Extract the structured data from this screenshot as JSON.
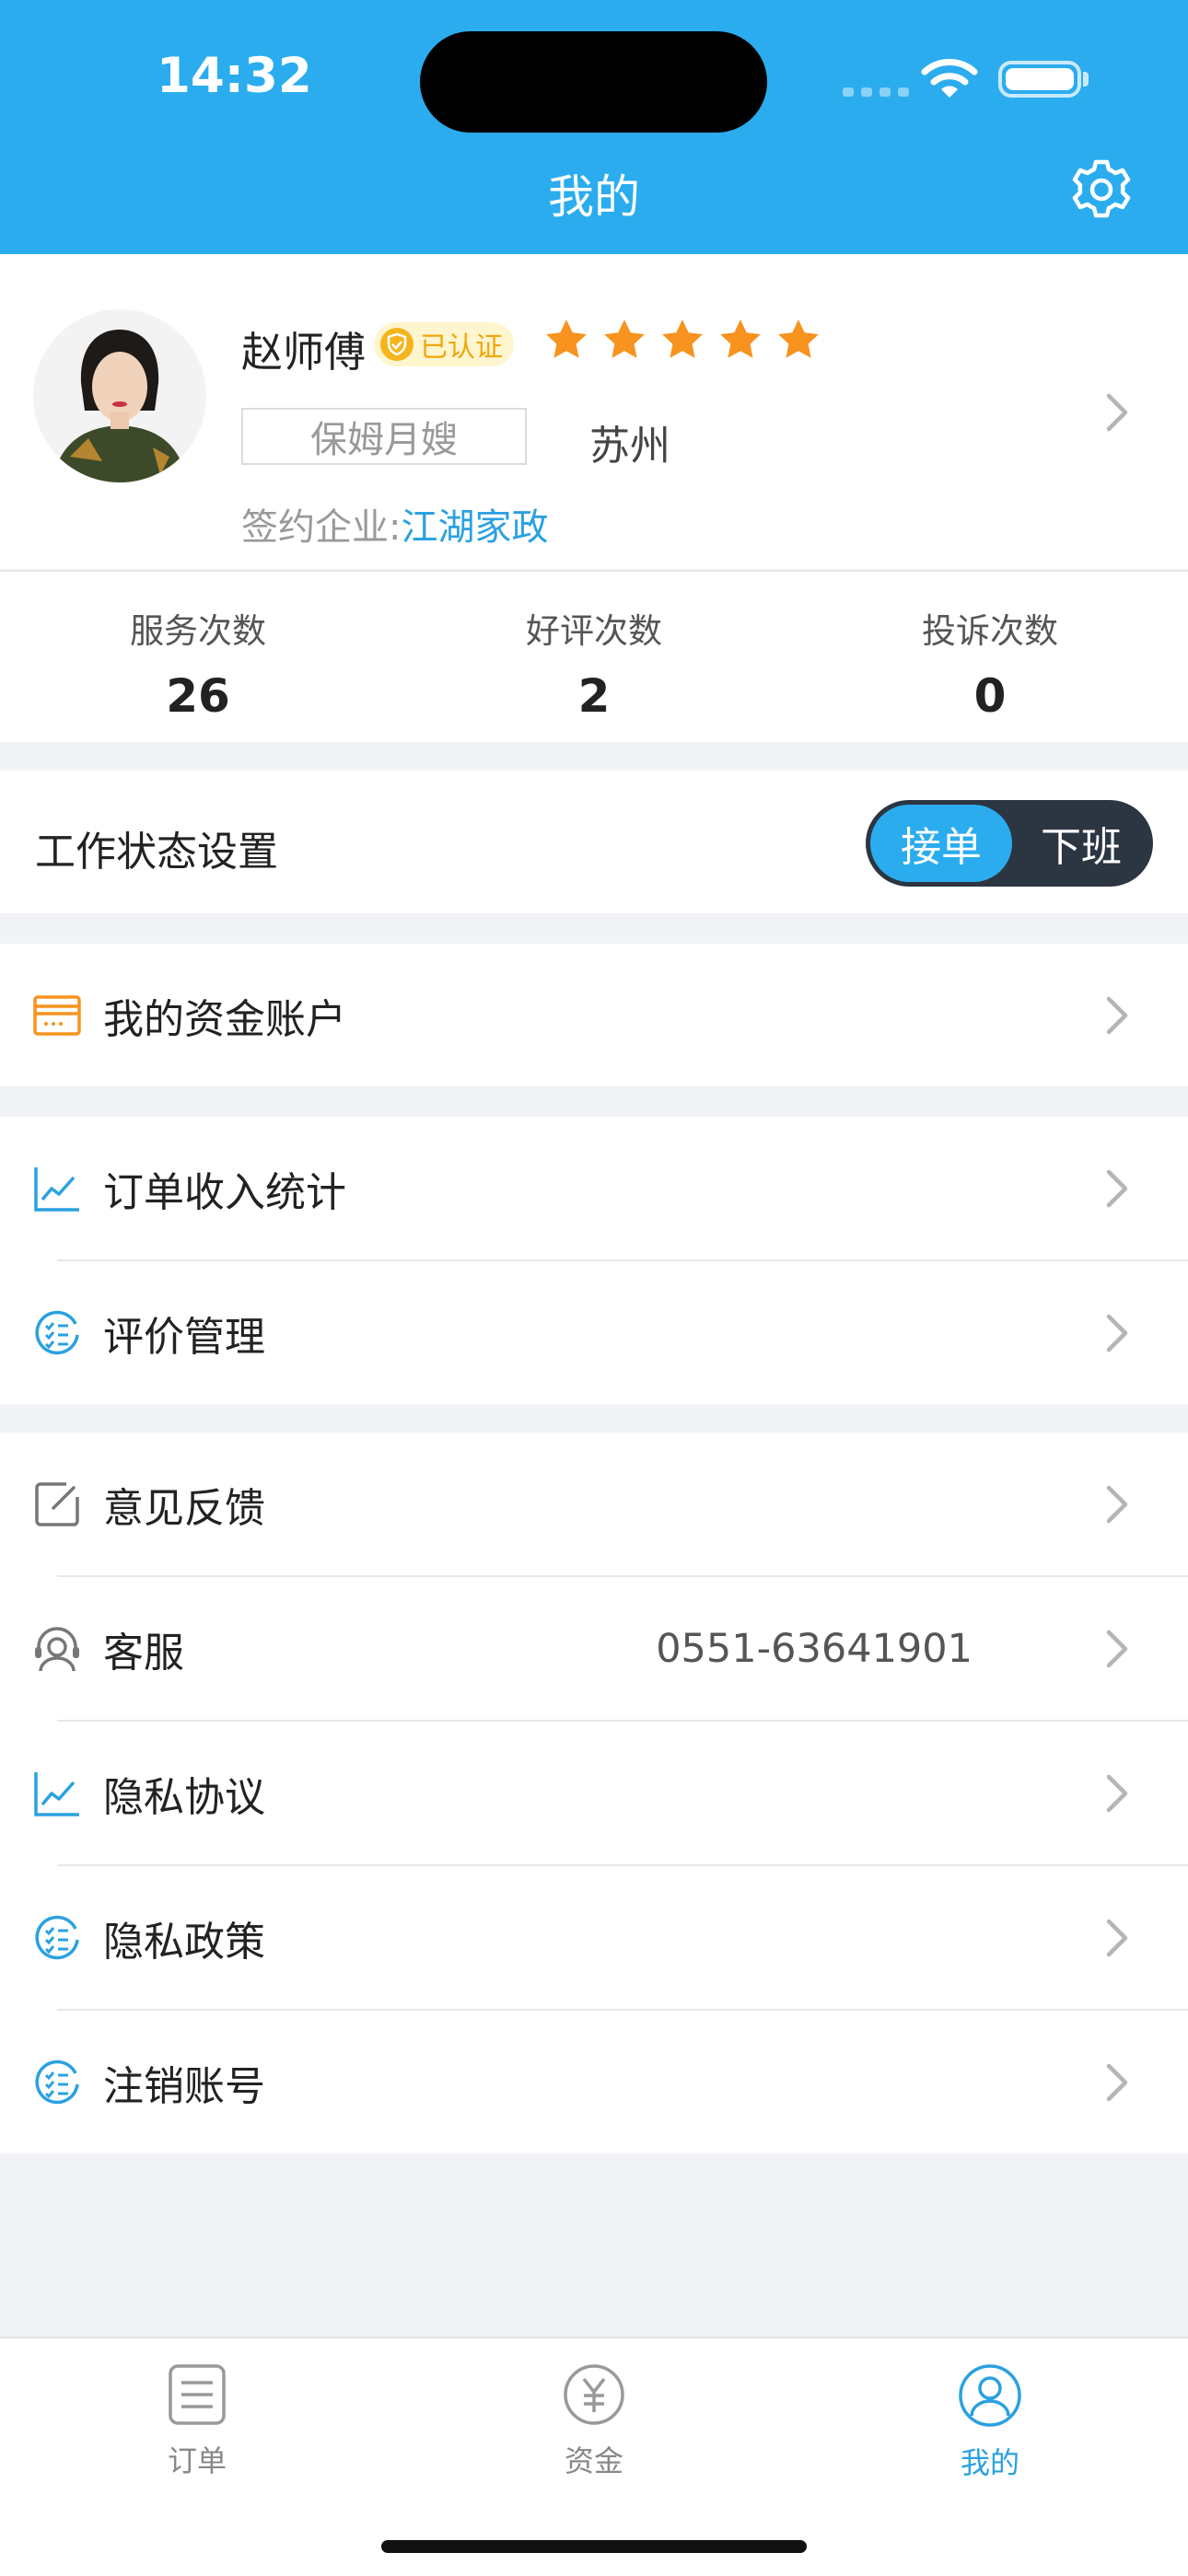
{
  "status_bar": {
    "time": "14:32"
  },
  "header": {
    "title": "我的",
    "settings_icon": "gear-icon"
  },
  "profile": {
    "name": "赵师傅",
    "verified_label": "已认证",
    "rating_stars": 5,
    "role": "保姆月嫂",
    "city": "苏州",
    "company_prefix": "签约企业:",
    "company_name": "江湖家政"
  },
  "stats": [
    {
      "label": "服务次数",
      "value": "26"
    },
    {
      "label": "好评次数",
      "value": "2"
    },
    {
      "label": "投诉次数",
      "value": "0"
    }
  ],
  "work_status": {
    "label": "工作状态设置",
    "on_label": "接单",
    "off_label": "下班",
    "selected": "接单"
  },
  "menu": {
    "account": {
      "label": "我的资金账户",
      "icon": "wallet-card-icon"
    },
    "income": {
      "label": "订单收入统计",
      "icon": "line-chart-icon"
    },
    "reviews": {
      "label": "评价管理",
      "icon": "checklist-icon"
    },
    "feedback": {
      "label": "意见反馈",
      "icon": "edit-note-icon"
    },
    "service": {
      "label": "客服",
      "value": "0551-63641901",
      "icon": "headset-icon"
    },
    "privacy_agreement": {
      "label": "隐私协议",
      "icon": "line-chart-icon"
    },
    "privacy_policy": {
      "label": "隐私政策",
      "icon": "checklist-icon"
    },
    "delete_account": {
      "label": "注销账号",
      "icon": "checklist-icon"
    }
  },
  "tabbar": {
    "orders": {
      "label": "订单",
      "icon": "list-icon"
    },
    "funds": {
      "label": "资金",
      "icon": "yuan-icon"
    },
    "mine": {
      "label": "我的",
      "icon": "person-icon",
      "active": true
    }
  },
  "colors": {
    "primary": "#2bacef",
    "link": "#2aa1e0",
    "star": "#f7931e",
    "toggle_dark": "#2c3542",
    "badge_text": "#f0a70a"
  }
}
